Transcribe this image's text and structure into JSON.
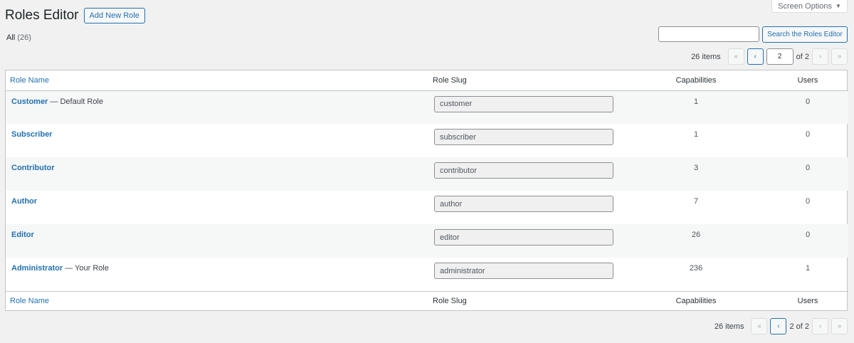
{
  "header": {
    "title": "Roles Editor",
    "add_new_label": "Add New Role",
    "screen_options_label": "Screen Options",
    "screen_options_arrow": "▼"
  },
  "views": {
    "all_label": "All",
    "all_count": "(26)"
  },
  "search": {
    "value": "",
    "button_label": "Search the Roles Editor"
  },
  "pagination_top": {
    "items_label": "26 items",
    "first": "«",
    "prev": "‹",
    "current_page": "2",
    "of_label": "of 2",
    "next": "›",
    "last": "»"
  },
  "pagination_bottom": {
    "items_label": "26 items",
    "first": "«",
    "prev": "‹",
    "page_text": "2 of 2",
    "next": "›",
    "last": "»"
  },
  "table": {
    "columns": [
      "Role Name",
      "Role Slug",
      "Capabilities",
      "Users"
    ],
    "rows": [
      {
        "name": "Customer",
        "suffix": "— Default Role",
        "slug": "customer",
        "capabilities": "1",
        "users": "0"
      },
      {
        "name": "Subscriber",
        "suffix": "",
        "slug": "subscriber",
        "capabilities": "1",
        "users": "0"
      },
      {
        "name": "Contributor",
        "suffix": "",
        "slug": "contributor",
        "capabilities": "3",
        "users": "0"
      },
      {
        "name": "Author",
        "suffix": "",
        "slug": "author",
        "capabilities": "7",
        "users": "0"
      },
      {
        "name": "Editor",
        "suffix": "",
        "slug": "editor",
        "capabilities": "26",
        "users": "0"
      },
      {
        "name": "Administrator",
        "suffix": "— Your Role",
        "slug": "administrator",
        "capabilities": "236",
        "users": "1"
      }
    ]
  }
}
